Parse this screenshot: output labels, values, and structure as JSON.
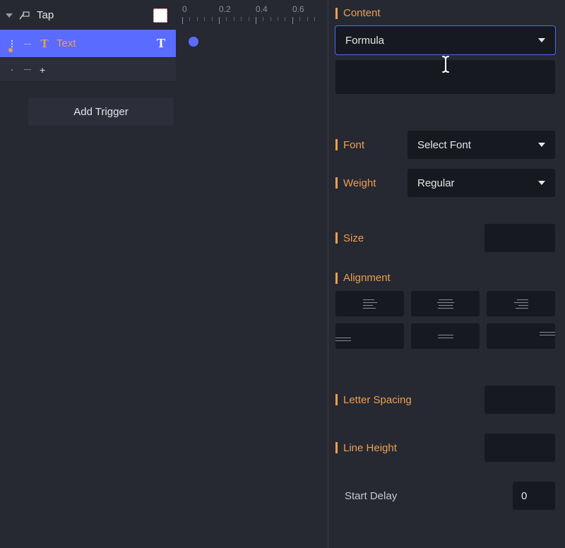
{
  "tree": {
    "tapLabel": "Tap",
    "textLayerLabel": "Text"
  },
  "buttons": {
    "addTrigger": "Add Trigger"
  },
  "ruler": {
    "ticks": [
      "0",
      "0.2",
      "0.4",
      "0.6"
    ]
  },
  "props": {
    "content": {
      "label": "Content",
      "selectValue": "Formula"
    },
    "font": {
      "label": "Font",
      "value": "Select Font"
    },
    "weight": {
      "label": "Weight",
      "value": "Regular"
    },
    "size": {
      "label": "Size",
      "value": ""
    },
    "alignment": {
      "label": "Alignment"
    },
    "letterSpacing": {
      "label": "Letter Spacing",
      "value": ""
    },
    "lineHeight": {
      "label": "Line Height",
      "value": ""
    },
    "startDelay": {
      "label": "Start Delay",
      "value": "0"
    }
  }
}
